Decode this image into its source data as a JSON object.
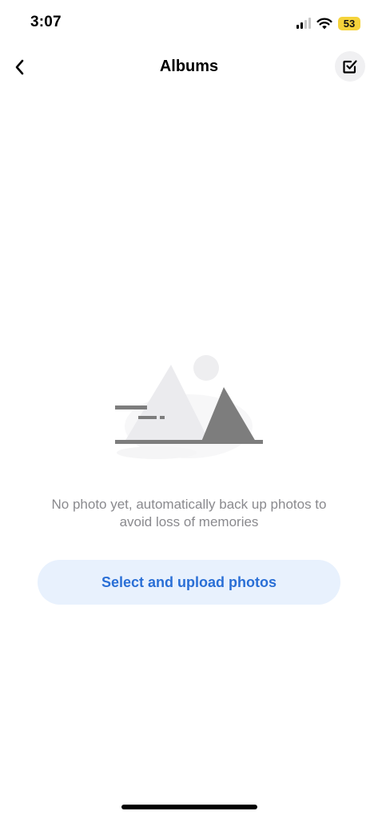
{
  "status_bar": {
    "time": "3:07",
    "battery_level": "53",
    "battery_color": "#f5d33b",
    "signal_bars_active": 2,
    "signal_bars_total": 4
  },
  "header": {
    "title": "Albums",
    "back_icon": "chevron-left-icon",
    "select_icon": "checkbox-icon"
  },
  "empty_state": {
    "illustration_icon": "image-placeholder-icon",
    "message": "No photo yet, automatically back up photos to avoid loss of memories",
    "upload_button_label": "Select and upload photos"
  },
  "colors": {
    "accent": "#2a6fd6",
    "button_background": "#e8f1fd",
    "muted_text": "#8a8a8e"
  }
}
